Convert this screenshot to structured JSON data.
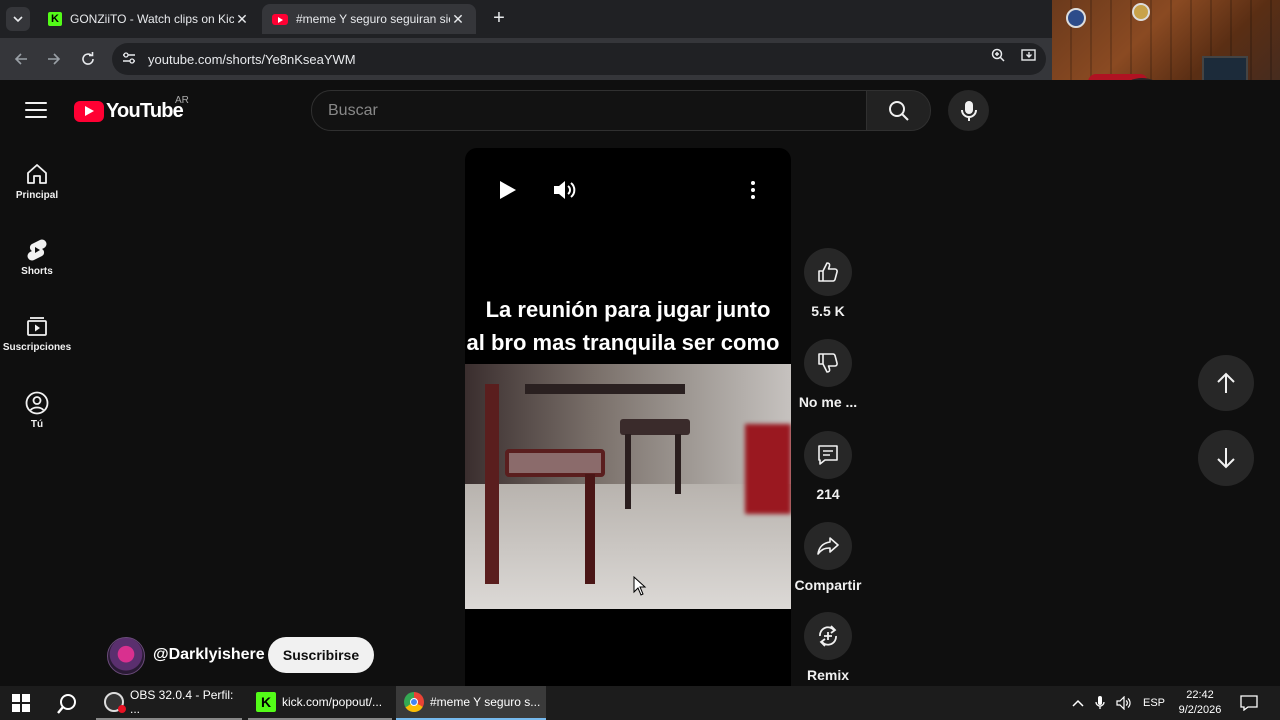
{
  "browser": {
    "tabs": [
      {
        "title": "GONZiiTO - Watch clips on Kick",
        "favicon": "kick-icon"
      },
      {
        "title": "#meme Y seguro seguiran sien",
        "favicon": "youtube-icon",
        "active": true
      }
    ],
    "url": "youtube.com/shorts/Ye8nKseaYWM"
  },
  "youtube": {
    "country": "AR",
    "search_placeholder": "Buscar",
    "sidebar": [
      {
        "label": "Principal",
        "icon": "home-icon"
      },
      {
        "label": "Shorts",
        "icon": "shorts-icon"
      },
      {
        "label": "Suscripciones",
        "icon": "subscriptions-icon"
      },
      {
        "label": "Tú",
        "icon": "user-icon"
      }
    ],
    "short": {
      "caption_line1": "La reunión para jugar junto",
      "caption_line2": "al bro mas tranquila ser como",
      "actions": {
        "like": "5.5 K",
        "dislike": "No me ...",
        "comments": "214",
        "share": "Compartir",
        "remix": "Remix"
      },
      "channel": "@Darklyishere",
      "subscribe": "Suscribirse"
    }
  },
  "taskbar": {
    "apps": [
      {
        "label": "OBS 32.0.4 - Perfil: ...",
        "icon": "obs-icon"
      },
      {
        "label": "kick.com/popout/...",
        "icon": "kick-icon"
      },
      {
        "label": "#meme Y seguro s...",
        "icon": "chrome-icon",
        "active": true
      }
    ],
    "language": "ESP",
    "time": "22:42",
    "date": "9/2/2026"
  },
  "colors": {
    "youtube_red": "#ff0033",
    "kick_green": "#53fc18",
    "background": "#0f0f0f"
  }
}
